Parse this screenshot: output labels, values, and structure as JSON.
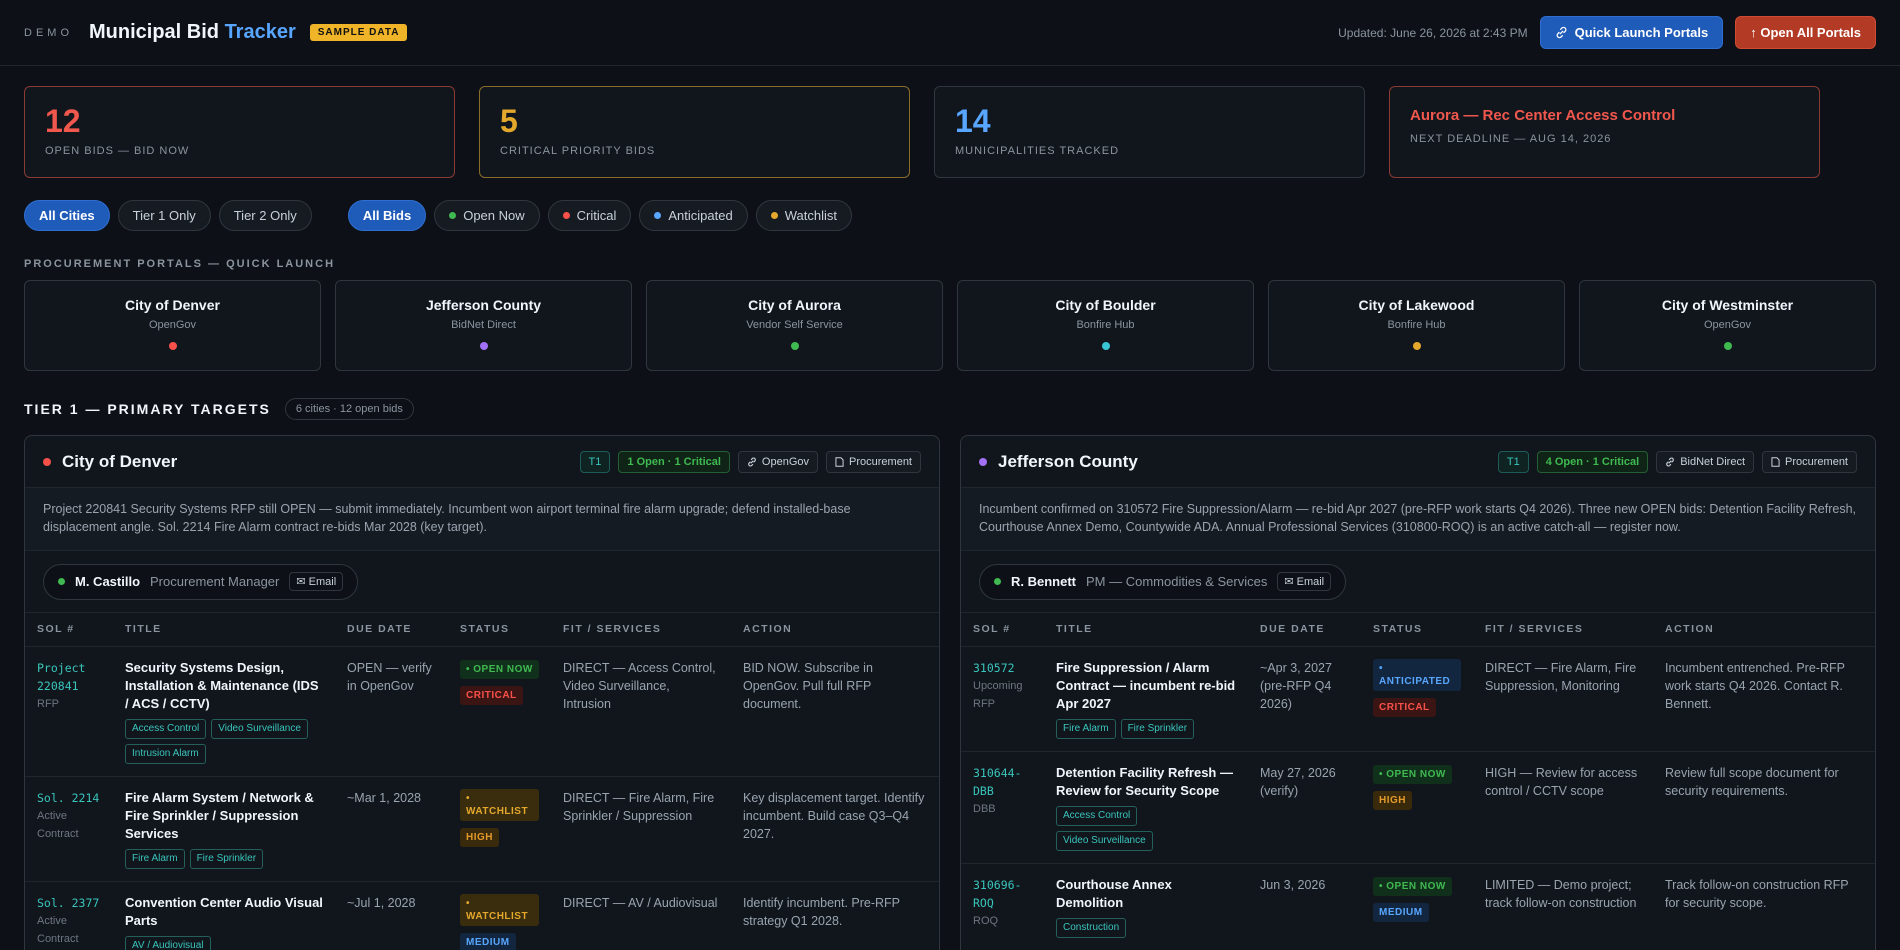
{
  "header": {
    "demo": "DEMO",
    "title_main": "Municipal Bid",
    "title_accent": "Tracker",
    "badge": "SAMPLE DATA",
    "updated": "Updated: June 26, 2026 at 2:43 PM",
    "quick_launch": "Quick Launch Portals",
    "open_all": "↑ Open All Portals"
  },
  "stats": [
    {
      "value": "12",
      "label": "OPEN BIDS — BID NOW",
      "color": "#f0574d"
    },
    {
      "value": "5",
      "label": "CRITICAL PRIORITY BIDS",
      "color": "#e3a72b"
    },
    {
      "value": "14",
      "label": "MUNICIPALITIES TRACKED",
      "color": "#58a6ff"
    }
  ],
  "next_deadline": {
    "title": "Aurora — Rec Center Access Control",
    "label": "NEXT DEADLINE — AUG 14, 2026"
  },
  "filters": {
    "city": [
      "All Cities",
      "Tier 1 Only",
      "Tier 2 Only"
    ],
    "bids": [
      {
        "label": "All Bids",
        "dot": ""
      },
      {
        "label": "Open Now",
        "dot": "#3fb950"
      },
      {
        "label": "Critical",
        "dot": "#f85149"
      },
      {
        "label": "Anticipated",
        "dot": "#58a6ff"
      },
      {
        "label": "Watchlist",
        "dot": "#e3a72b"
      }
    ]
  },
  "portals_heading": "PROCUREMENT PORTALS — QUICK LAUNCH",
  "portals": [
    {
      "name": "City of Denver",
      "platform": "OpenGov",
      "color": "#f85149"
    },
    {
      "name": "Jefferson County",
      "platform": "BidNet Direct",
      "color": "#a371f7"
    },
    {
      "name": "City of Aurora",
      "platform": "Vendor Self Service",
      "color": "#3fb950"
    },
    {
      "name": "City of Boulder",
      "platform": "Bonfire Hub",
      "color": "#39c5d6"
    },
    {
      "name": "City of Lakewood",
      "platform": "Bonfire Hub",
      "color": "#e3a72b"
    },
    {
      "name": "City of Westminster",
      "platform": "OpenGov",
      "color": "#3fb950"
    }
  ],
  "tier": {
    "title": "TIER 1 — PRIMARY TARGETS",
    "count": "6 cities · 12 open bids"
  },
  "columns": [
    "SOL #",
    "TITLE",
    "DUE DATE",
    "STATUS",
    "FIT / SERVICES",
    "ACTION"
  ],
  "denver": {
    "name": "City of Denver",
    "color": "#f85149",
    "tier": "T1",
    "summary": "1 Open · 1 Critical",
    "portal": "OpenGov",
    "procurement": "Procurement",
    "note": "Project 220841 Security Systems RFP still OPEN — submit immediately. Incumbent won airport terminal fire alarm upgrade; defend installed-base displacement angle. Sol. 2214 Fire Alarm contract re-bids Mar 2028 (key target).",
    "contact_name": "M. Castillo",
    "contact_role": "Procurement Manager",
    "email": "Email",
    "rows": [
      {
        "sol": "Project 220841",
        "sol_sub": "RFP",
        "title": "Security Systems Design, Installation & Maintenance (IDS / ACS / CCTV)",
        "tags": [
          "Access Control",
          "Video Surveillance",
          "Intrusion Alarm"
        ],
        "due": "OPEN — verify in OpenGov",
        "badges": [
          [
            "• OPEN NOW",
            "b-open"
          ],
          [
            "CRITICAL",
            "b-crit"
          ]
        ],
        "fit": "DIRECT — Access Control, Video Surveillance, Intrusion",
        "action": "BID NOW. Subscribe in OpenGov. Pull full RFP document."
      },
      {
        "sol": "Sol. 2214",
        "sol_sub": "Active Contract",
        "title": "Fire Alarm System / Network & Fire Sprinkler / Suppression Services",
        "tags": [
          "Fire Alarm",
          "Fire Sprinkler"
        ],
        "due": "~Mar 1, 2028",
        "badges": [
          [
            "• WATCHLIST",
            "b-watch"
          ],
          [
            "HIGH",
            "b-high"
          ]
        ],
        "fit": "DIRECT — Fire Alarm, Fire Sprinkler / Suppression",
        "action": "Key displacement target. Identify incumbent. Build case Q3–Q4 2027."
      },
      {
        "sol": "Sol. 2377",
        "sol_sub": "Active Contract",
        "title": "Convention Center Audio Visual Parts",
        "tags": [
          "AV / Audiovisual"
        ],
        "due": "~Jul 1, 2028",
        "badges": [
          [
            "• WATCHLIST",
            "b-watch"
          ],
          [
            "MEDIUM",
            "b-med"
          ]
        ],
        "fit": "DIRECT — AV / Audiovisual",
        "action": "Identify incumbent. Pre-RFP strategy Q1 2028."
      }
    ]
  },
  "jefferson": {
    "name": "Jefferson County",
    "color": "#a371f7",
    "tier": "T1",
    "summary": "4 Open · 1 Critical",
    "portal": "BidNet Direct",
    "procurement": "Procurement",
    "note": "Incumbent confirmed on 310572 Fire Suppression/Alarm — re-bid Apr 2027 (pre-RFP work starts Q4 2026). Three new OPEN bids: Detention Facility Refresh, Courthouse Annex Demo, Countywide ADA. Annual Professional Services (310800-ROQ) is an active catch-all — register now.",
    "contact_name": "R. Bennett",
    "contact_role": "PM — Commodities & Services",
    "email": "Email",
    "rows": [
      {
        "sol": "310572",
        "sol_sub": "Upcoming RFP",
        "title": "Fire Suppression / Alarm Contract — incumbent re-bid Apr 2027",
        "tags": [
          "Fire Alarm",
          "Fire Sprinkler"
        ],
        "due": "~Apr 3, 2027 (pre-RFP Q4 2026)",
        "badges": [
          [
            "• ANTICIPATED",
            "b-ant"
          ],
          [
            "CRITICAL",
            "b-crit"
          ]
        ],
        "fit": "DIRECT — Fire Alarm, Fire Suppression, Monitoring",
        "action": "Incumbent entrenched. Pre-RFP work starts Q4 2026. Contact R. Bennett."
      },
      {
        "sol": "310644-DBB",
        "sol_sub": "DBB",
        "title": "Detention Facility Refresh — Review for Security Scope",
        "tags": [
          "Access Control",
          "Video Surveillance"
        ],
        "due": "May 27, 2026 (verify)",
        "badges": [
          [
            "• OPEN NOW",
            "b-open"
          ],
          [
            "HIGH",
            "b-high"
          ]
        ],
        "fit": "HIGH — Review for access control / CCTV scope",
        "action": "Review full scope document for security requirements."
      },
      {
        "sol": "310696-ROQ",
        "sol_sub": "ROQ",
        "title": "Courthouse Annex Demolition",
        "tags": [
          "Construction"
        ],
        "due": "Jun 3, 2026",
        "badges": [
          [
            "• OPEN NOW",
            "b-open"
          ],
          [
            "MEDIUM",
            "b-med"
          ]
        ],
        "fit": "LIMITED — Demo project; track follow-on construction",
        "action": "Track follow-on construction RFP for security scope."
      }
    ]
  }
}
